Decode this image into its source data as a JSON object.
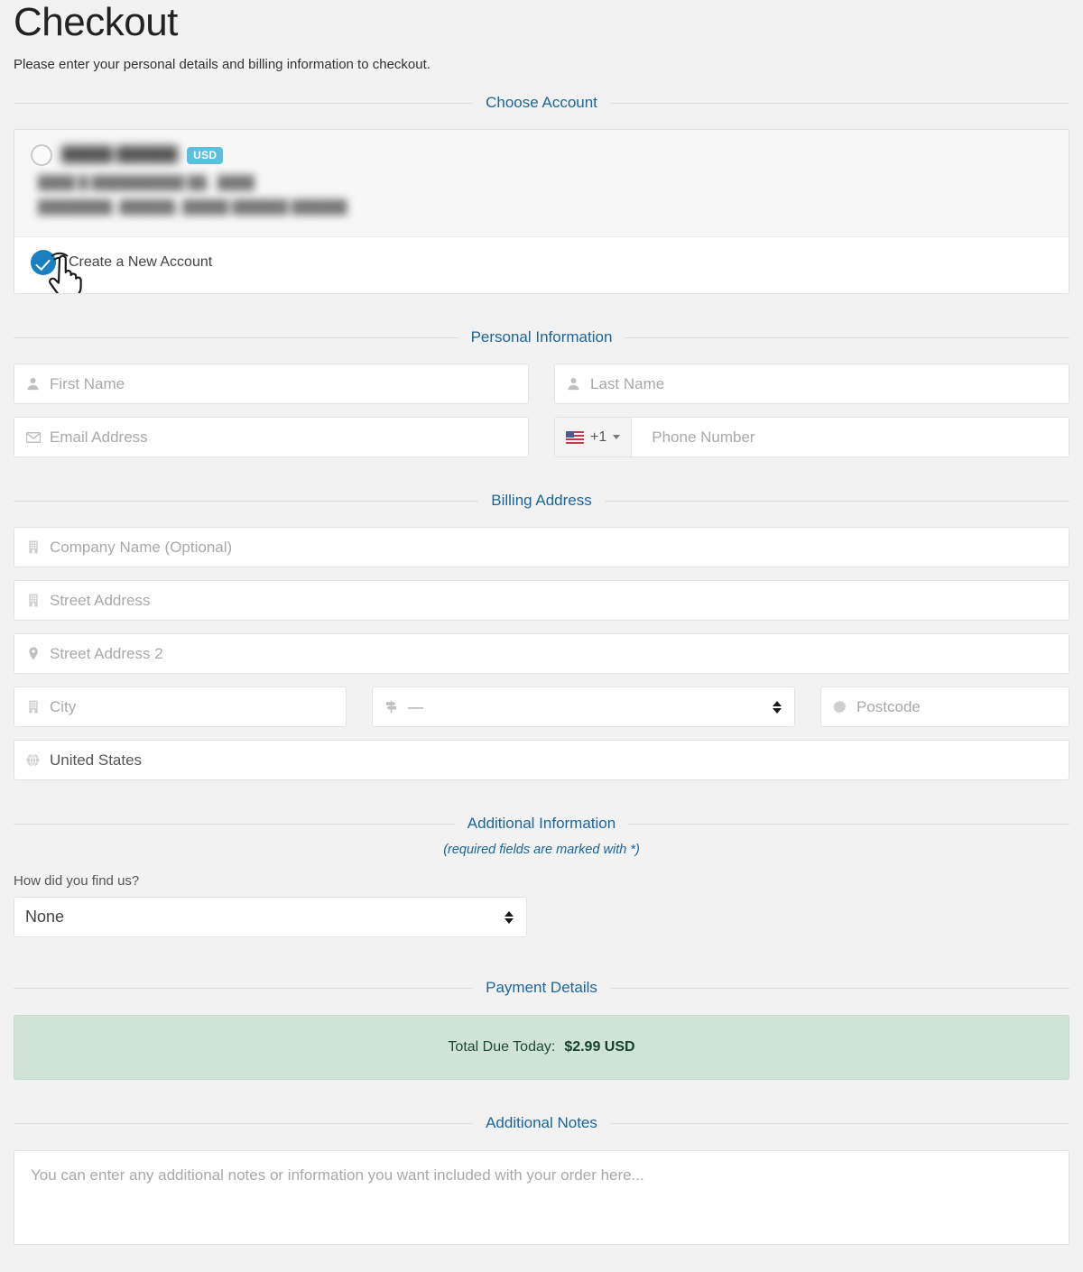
{
  "header": {
    "title": "Checkout",
    "subtitle": "Please enter your personal details and billing information to checkout."
  },
  "choose_account": {
    "legend": "Choose Account",
    "existing_account": {
      "name": "█████ ██████",
      "currency_badge": "USD",
      "address_line_1": "████ █ ██████████ ██., ████",
      "address_line_2": "████████, ██████, █████ ██████ ██████",
      "redacted": true
    },
    "new_account": {
      "label": "Create a New Account",
      "selected": true
    }
  },
  "personal_information": {
    "legend": "Personal Information",
    "first_name": {
      "placeholder": "First Name",
      "value": "",
      "icon": "user-icon"
    },
    "last_name": {
      "placeholder": "Last Name",
      "value": "",
      "icon": "user-icon"
    },
    "email": {
      "placeholder": "Email Address",
      "value": "",
      "icon": "envelope-icon"
    },
    "phone": {
      "placeholder": "Phone Number",
      "value": "",
      "dial_code": "+1",
      "country_flag": "us-flag-icon"
    }
  },
  "billing_address": {
    "legend": "Billing Address",
    "company": {
      "placeholder": "Company Name (Optional)",
      "value": "",
      "icon": "building-icon"
    },
    "street": {
      "placeholder": "Street Address",
      "value": "",
      "icon": "building-icon"
    },
    "street2": {
      "placeholder": "Street Address 2",
      "value": "",
      "icon": "map-marker-icon"
    },
    "city": {
      "placeholder": "City",
      "value": "",
      "icon": "building-icon"
    },
    "state": {
      "selected": "—",
      "icon": "map-signs-icon"
    },
    "postcode": {
      "placeholder": "Postcode",
      "value": "",
      "icon": "certificate-icon"
    },
    "country": {
      "selected": "United States",
      "icon": "globe-icon"
    }
  },
  "additional_information": {
    "legend": "Additional Information",
    "note": "(required fields are marked with *)",
    "how_found_label": "How did you find us?",
    "how_found_value": "None"
  },
  "payment_details": {
    "legend": "Payment Details",
    "total_label": "Total Due Today:",
    "total_amount": "$2.99 USD"
  },
  "additional_notes": {
    "legend": "Additional Notes",
    "placeholder": "You can enter any additional notes or information you want included with your order here..."
  },
  "colors": {
    "page_background": "#f2f2f2",
    "legend_text": "#1b659c",
    "accent_blue": "#1a7fc1",
    "badge_blue": "#5bc0de",
    "total_background": "#cfe4d6",
    "total_text": "#14432a",
    "placeholder_text": "#a9a9a9"
  }
}
